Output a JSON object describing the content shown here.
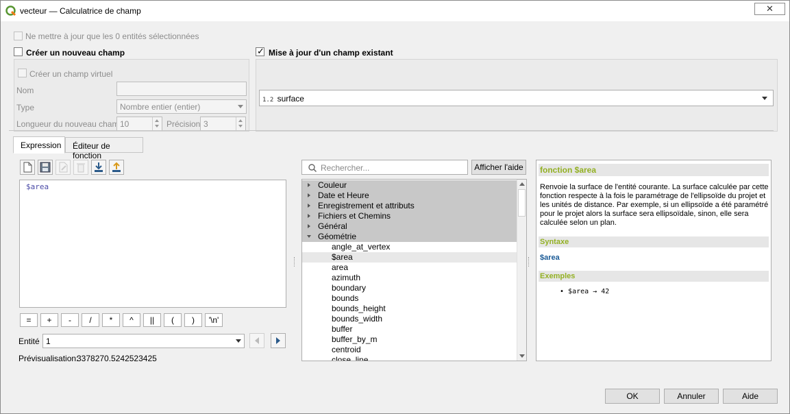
{
  "window": {
    "title": "vecteur — Calculatrice de champ",
    "close_glyph": "✕"
  },
  "options": {
    "update_selected_label": "Ne mettre à jour que les 0 entités sélectionnées",
    "create_field_label": "Créer un nouveau champ",
    "update_field_label": "Mise à jour d'un champ existant",
    "create_virtual_label": "Créer un champ virtuel",
    "name_label": "Nom",
    "name_value": "",
    "type_label": "Type",
    "type_value": "Nombre entier (entier)",
    "length_label": "Longueur du nouveau champ",
    "length_value": "10",
    "precision_label": "Précision",
    "precision_value": "3",
    "existing_field_type": "1.2",
    "existing_field_value": "surface"
  },
  "tabs": [
    {
      "label": "Expression",
      "active": true
    },
    {
      "label": "Éditeur de fonction",
      "active": false
    }
  ],
  "toolbar_icons": [
    "new-file-icon",
    "save-icon",
    "edit-icon",
    "delete-icon",
    "import-icon",
    "export-icon"
  ],
  "editor": {
    "expression": "$area"
  },
  "operators": [
    "=",
    "+",
    "-",
    "/",
    "*",
    "^",
    "||",
    "(",
    ")",
    "'\\n'"
  ],
  "entity": {
    "label": "Entité",
    "value": "1"
  },
  "preview": {
    "label": "Prévisualisation:",
    "value": "3378270.5242523425"
  },
  "search": {
    "placeholder": "Rechercher...",
    "help_button": "Afficher l'aide"
  },
  "tree": {
    "groups": [
      "Couleur",
      "Date et Heure",
      "Enregistrement et attributs",
      "Fichiers et Chemins",
      "Général",
      "Géométrie"
    ],
    "expanded_group": "Géométrie",
    "children": [
      "angle_at_vertex",
      "$area",
      "area",
      "azimuth",
      "boundary",
      "bounds",
      "bounds_height",
      "bounds_width",
      "buffer",
      "buffer_by_m",
      "centroid",
      "close_line"
    ],
    "selected_child": "$area"
  },
  "help": {
    "title": "fonction $area",
    "description": "Renvoie la surface de l'entité courante. La surface calculée par cette fonction respecte à la fois le paramétrage de l'ellipsoïde du projet et les unités de distance. Par exemple, si un ellipsoïde a été paramétré pour le projet alors la surface sera ellipsoïdale, sinon, elle sera calculée selon un plan.",
    "syntax_heading": "Syntaxe",
    "syntax": "$area",
    "examples_heading": "Exemples",
    "example": "$area → 42",
    "heading_color": "#93b023",
    "syntax_color": "#1a5a96"
  },
  "buttons": {
    "ok": "OK",
    "cancel": "Annuler",
    "help": "Aide"
  }
}
